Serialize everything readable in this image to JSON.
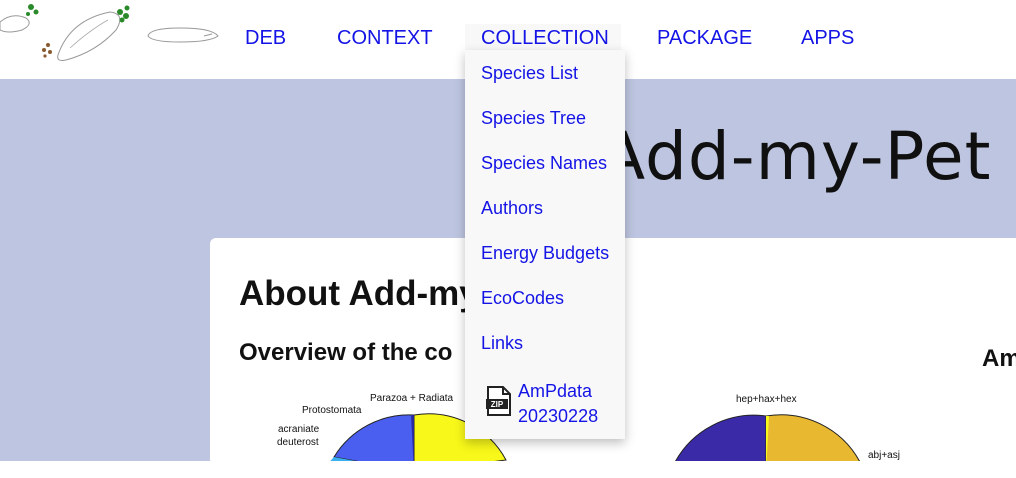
{
  "nav": {
    "items": [
      "DEB",
      "CONTEXT",
      "COLLECTION",
      "PACKAGE",
      "APPS"
    ]
  },
  "banner": {
    "title": "Add-my-Pet"
  },
  "main": {
    "title": "About Add-my",
    "overview_heading": "Overview of the co",
    "right_heading": "Am"
  },
  "chart_left": {
    "labels": [
      "Parazoa + Radiata",
      "Protostomata",
      "acraniate",
      "deuterost"
    ]
  },
  "chart_right": {
    "labels": [
      "hep+hax+hex",
      "abj+asj"
    ]
  },
  "dropdown": {
    "items": [
      "Species List",
      "Species Tree",
      "Species Names",
      "Authors",
      "Energy Budgets",
      "EcoCodes",
      "Links"
    ],
    "zip_line1": "AmPdata",
    "zip_line2": "20230228",
    "zip_icon_text": "ZIP"
  },
  "colors": {
    "link": "#1414e6",
    "banner_bg": "#bec5e0",
    "pie_blue": "#4a5ef0",
    "pie_yellow": "#f8f81a",
    "pie_purple": "#3a2aa8",
    "pie_gold": "#e8b830"
  }
}
